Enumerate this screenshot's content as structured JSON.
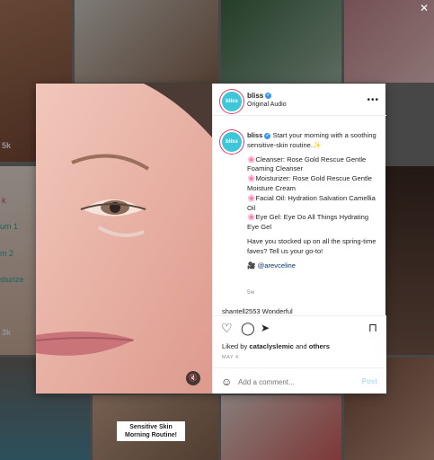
{
  "background_tiles": {
    "counts": [
      "5k",
      "3k"
    ],
    "left_labels": [
      "k",
      "um 1",
      "m 2",
      "sturize"
    ],
    "banner_text": "Sensitive Skin Morning Routine!"
  },
  "post": {
    "header": {
      "username": "bliss",
      "subtitle": "Original Audio",
      "avatar_text": "bliss"
    },
    "caption": {
      "username": "bliss",
      "intro": "Start your morning with a soothing sensitive-skin routine.✨",
      "items": [
        "🌸Cleanser: Rose Gold Rescue Gentle Foaming Cleanser",
        "🌸Moisturizer: Rose Gold Rescue Gentle Moisture Cream",
        "🌸Facial Oil: Hydration Salvation Camellia Oil",
        "🌸Eye Gel: Eye Do All Things Hydrating Eye Gel"
      ],
      "question": "Have you stocked up on all the spring-time faves? Tell us your go-to!",
      "credit_icon": "🎥",
      "credit": "@arevceline",
      "time": "5w"
    },
    "comment_preview": "shantell2553 Wonderful",
    "likes_prefix": "Liked by",
    "likes_user": "cataclyslemic",
    "likes_and": "and",
    "likes_others": "others",
    "date": "MAY 4",
    "add_comment_placeholder": "Add a comment...",
    "post_label": "Post"
  },
  "colors": {
    "accent_blue": "#3897f0",
    "brand_teal": "#3ec7d8",
    "post_disabled": "#b2dffc"
  }
}
